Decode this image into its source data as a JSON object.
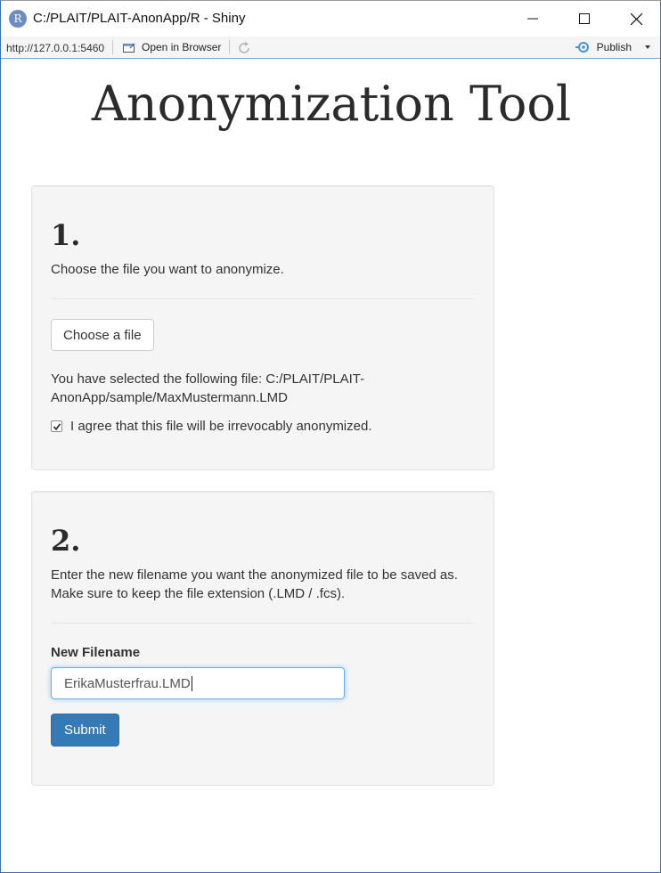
{
  "window": {
    "title": "C:/PLAIT/PLAIT-AnonApp/R - Shiny",
    "logo_letter": "R"
  },
  "toolbar": {
    "url": "http://127.0.0.1:5460",
    "open_in_browser_label": "Open in Browser",
    "publish_label": "Publish"
  },
  "app": {
    "title": "Anonymization Tool"
  },
  "step1": {
    "number": "1.",
    "description": "Choose the file you want to anonymize.",
    "choose_file_label": "Choose a file",
    "selected_file_line1": "You have selected the following file: C:/PLAIT/PLAIT-",
    "selected_file_line2": "AnonApp/sample/MaxMustermann.LMD",
    "agree_label": "I agree that this file will be irrevocably anonymized.",
    "agree_checked": true
  },
  "step2": {
    "number": "2.",
    "description_line1": "Enter the new filename you want the anonymized file to be saved as.",
    "description_line2": "Make sure to keep the file extension (.LMD / .fcs).",
    "filename_label": "New Filename",
    "filename_value": "ErikaMusterfrau.LMD",
    "submit_label": "Submit"
  },
  "colors": {
    "primary": "#337ab7",
    "focus": "#66afe9",
    "well_bg": "#f5f5f5"
  }
}
